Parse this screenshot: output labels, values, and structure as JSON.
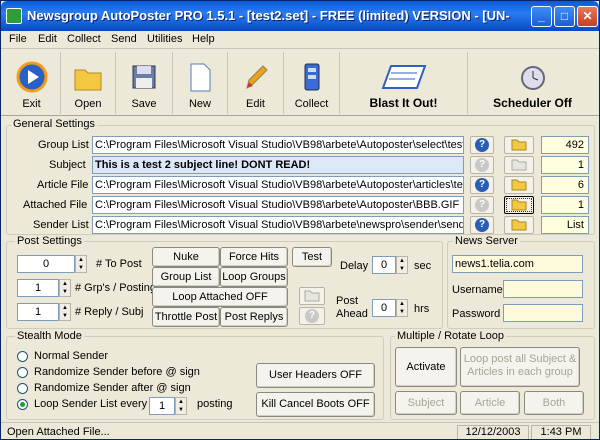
{
  "window": {
    "title": "Newsgroup AutoPoster PRO 1.5.1 - [test2.set] - FREE (limited) VERSION - [UN-"
  },
  "menu": [
    "File",
    "Edit",
    "Collect",
    "Send",
    "Utilities",
    "Help"
  ],
  "toolbar": {
    "exit": "Exit",
    "open": "Open",
    "save": "Save",
    "new": "New",
    "edit": "Edit",
    "collect": "Collect",
    "blast": "Blast It Out!",
    "scheduler": "Scheduler Off"
  },
  "general": {
    "legend": "General Settings",
    "group_list": {
      "label": "Group List",
      "value": "C:\\Program Files\\Microsoft Visual Studio\\VB98\\arbete\\Autoposter\\select\\test",
      "count": "492"
    },
    "subject": {
      "label": "Subject",
      "value": "This is a test 2 subject line! DONT READ!",
      "count": "1"
    },
    "article_file": {
      "label": "Article File",
      "value": "C:\\Program Files\\Microsoft Visual Studio\\VB98\\arbete\\Autoposter\\articles\\te",
      "count": "6"
    },
    "attached_file": {
      "label": "Attached File",
      "value": "C:\\Program Files\\Microsoft Visual Studio\\VB98\\arbete\\Autoposter\\BBB.GIF",
      "count": "1"
    },
    "sender_list": {
      "label": "Sender List",
      "value": "C:\\Program Files\\Microsoft Visual Studio\\VB98\\arbete\\newspro\\sender\\send",
      "count": "List"
    }
  },
  "post": {
    "legend": "Post Settings",
    "to_post": {
      "value": "0",
      "label": "# To Post"
    },
    "grps_posting": {
      "value": "1",
      "label": "# Grp's / Posting"
    },
    "reply_subj": {
      "value": "1",
      "label": "# Reply / Subj"
    },
    "buttons": {
      "nuke": "Nuke",
      "force_hits": "Force Hits",
      "test": "Test",
      "group_list": "Group List",
      "loop_groups": "Loop Groups",
      "loop_attached": "Loop Attached OFF",
      "throttle": "Throttle Post",
      "post_replys": "Post Replys"
    },
    "delay": {
      "label": "Delay",
      "value": "0",
      "unit": "sec"
    },
    "ahead": {
      "label1": "Post",
      "label2": "Ahead",
      "value": "0",
      "unit": "hrs"
    }
  },
  "server": {
    "legend": "News Server",
    "host": "news1.telia.com",
    "username_label": "Username",
    "password_label": "Password"
  },
  "stealth": {
    "legend": "Stealth Mode",
    "options": [
      "Normal Sender",
      "Randomize Sender before @ sign",
      "Randomize Sender after @ sign",
      "Loop Sender List every"
    ],
    "selected": 3,
    "every_value": "1",
    "posting": "posting",
    "user_headers": "User Headers OFF",
    "kill_cancel": "Kill Cancel Boots OFF"
  },
  "rotate": {
    "legend": "Multiple / Rotate Loop",
    "activate": "Activate",
    "loop_all": "Loop post all Subject & Articles in each group",
    "subject": "Subject",
    "article": "Article",
    "both": "Both"
  },
  "status": {
    "message": "Open Attached File...",
    "date": "12/12/2003",
    "time": "1:43 PM"
  },
  "colors": {
    "titlebar": "#0a5bd8",
    "face": "#ece9d8",
    "subject_bg": "#dce8f8",
    "count_bg": "#ffffe0"
  }
}
